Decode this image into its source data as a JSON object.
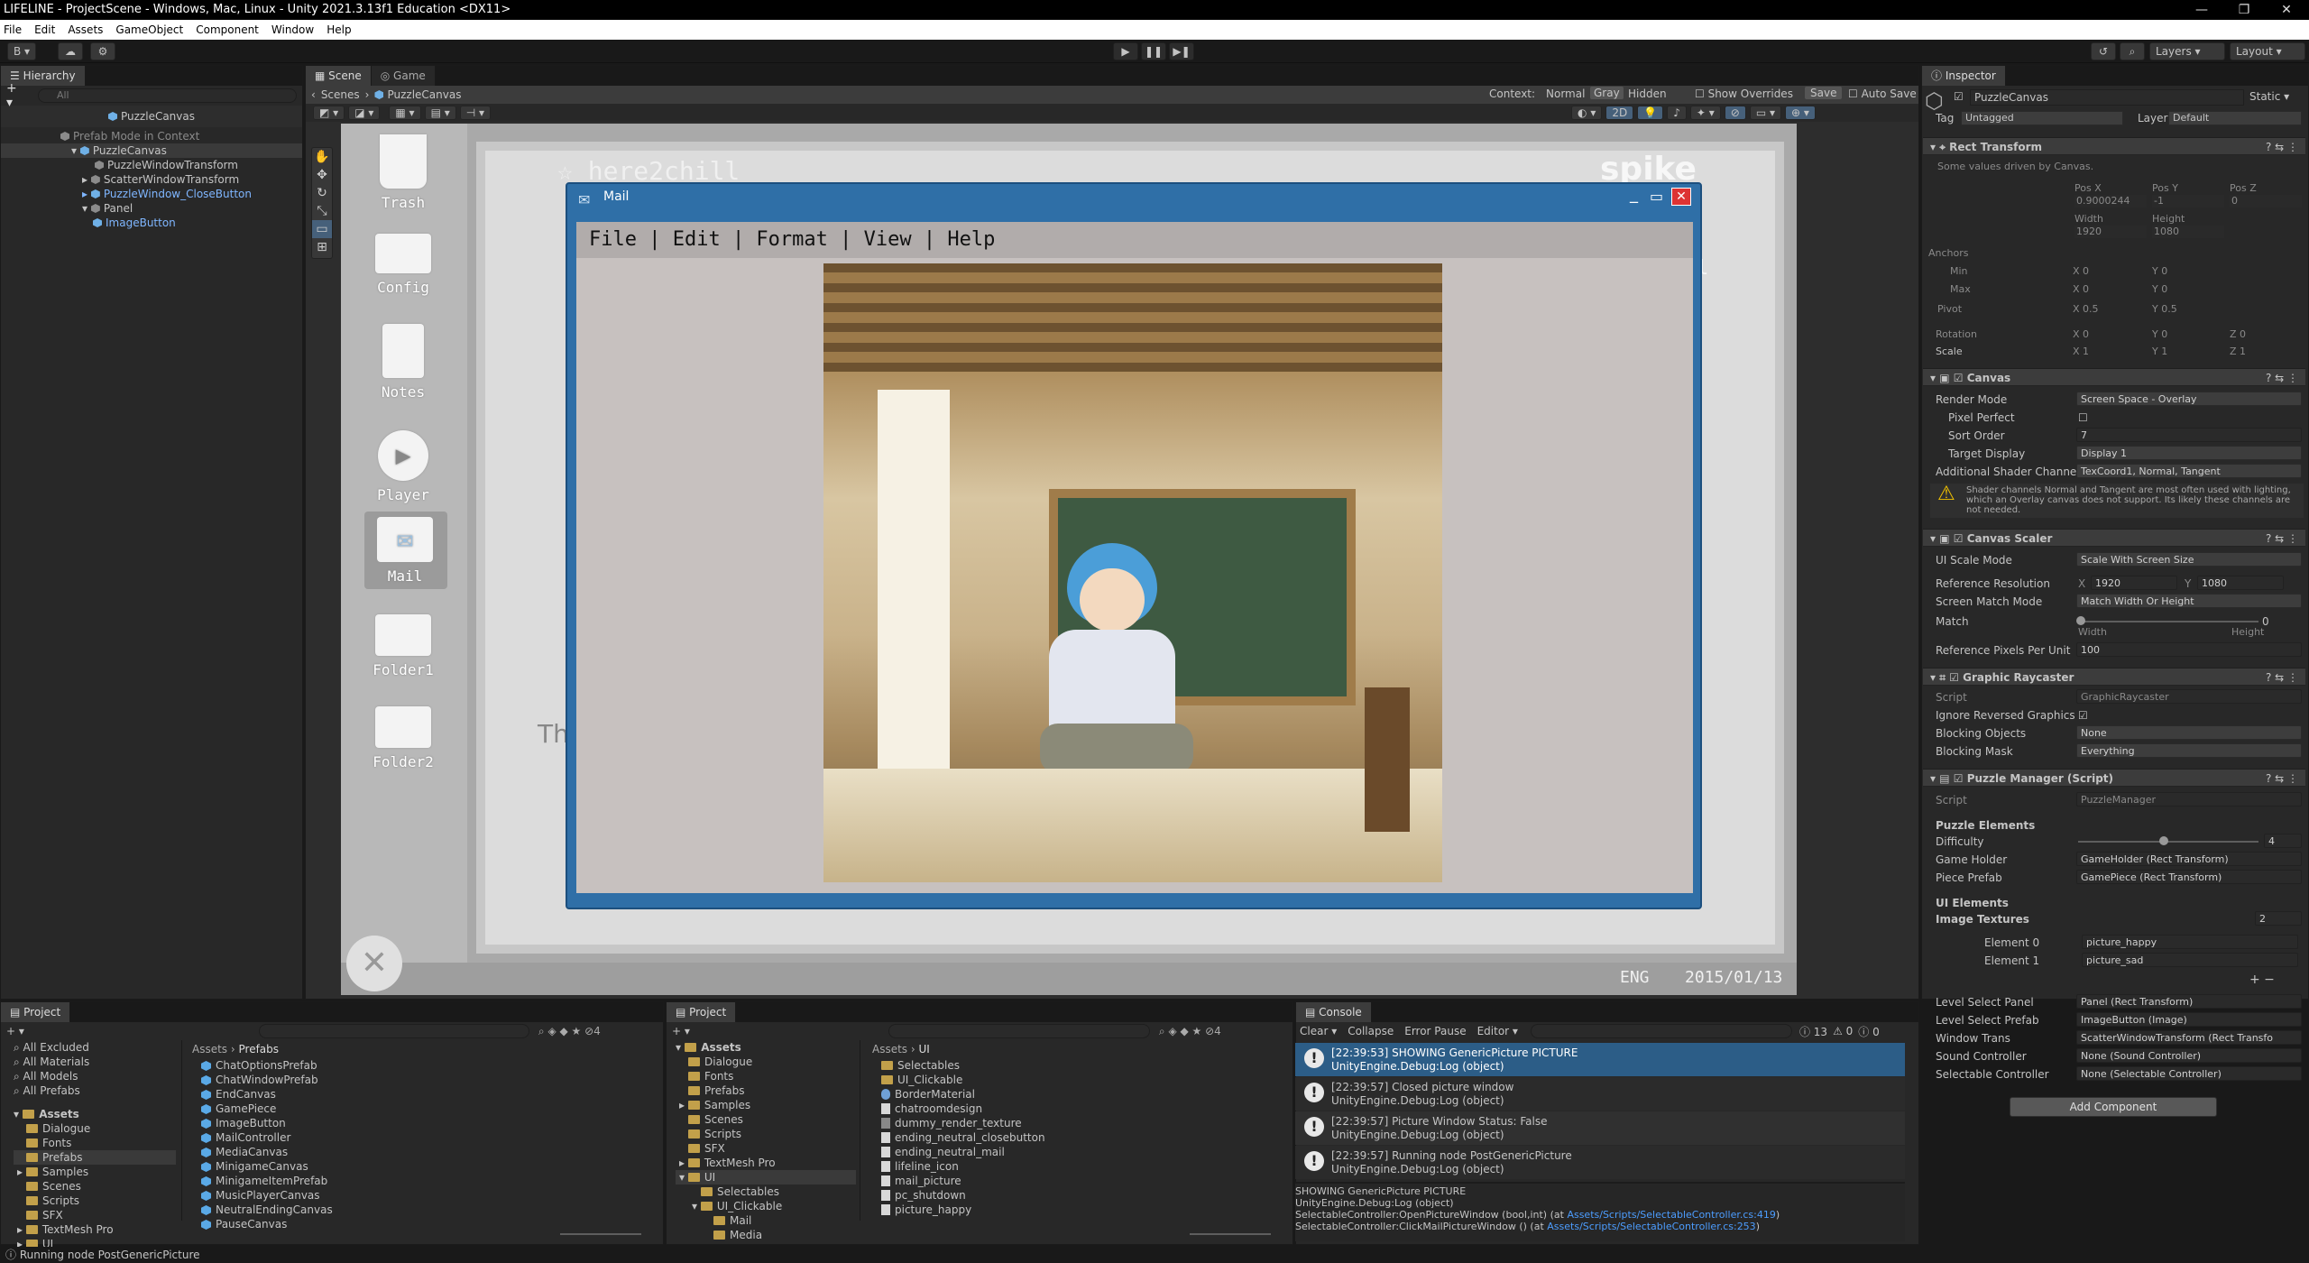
{
  "window": {
    "title": "LIFELINE - ProjectScene - Windows, Mac, Linux - Unity 2021.3.13f1 Education <DX11>",
    "controls": [
      "—",
      "❐",
      "✕"
    ]
  },
  "menubar": [
    "File",
    "Edit",
    "Assets",
    "GameObject",
    "Component",
    "Window",
    "Help"
  ],
  "toolbar": {
    "account": "B ▾",
    "layers": "Layers",
    "layout": "Layout"
  },
  "hierarchy": {
    "tab": "Hierarchy",
    "search_placeholder": "All",
    "root": "PuzzleCanvas",
    "items": [
      {
        "label": "Prefab Mode in Context",
        "indent": 3,
        "style": "gray"
      },
      {
        "label": "PuzzleCanvas",
        "indent": 4,
        "style": "sel"
      },
      {
        "label": "PuzzleWindowTransform",
        "indent": 5,
        "style": "normal"
      },
      {
        "label": "ScatterWindowTransform",
        "indent": 5,
        "style": "normal"
      },
      {
        "label": "PuzzleWindow_CloseButton",
        "indent": 5,
        "style": "blue"
      },
      {
        "label": "Panel",
        "indent": 5,
        "style": "normal"
      },
      {
        "label": "ImageButton",
        "indent": 6,
        "style": "blue"
      }
    ]
  },
  "scene": {
    "tabs": [
      "Scene",
      "Game"
    ],
    "breadcrumb": [
      "Scenes",
      "PuzzleCanvas"
    ],
    "context_label": "Context:",
    "context_options": [
      "Normal",
      "Gray",
      "Hidden"
    ],
    "show_overrides": "Show Overrides",
    "save": "Save",
    "auto_save": "Auto Save",
    "mode_2d": "2D"
  },
  "game": {
    "desktop_icons": [
      "Trash",
      "Config",
      "Notes",
      "Player",
      "Mail",
      "Folder1",
      "Folder2"
    ],
    "mail_title": "Mail",
    "mail_menu": "File | Edit | Format | View | Help",
    "bg_logo": "here2chill",
    "bg_brand": "spike",
    "bg_chat": "chill",
    "bg_text": "Th",
    "taskbar_lang": "ENG",
    "taskbar_date": "2015/01/13"
  },
  "inspector": {
    "tab": "Inspector",
    "object_name": "PuzzleCanvas",
    "static": "Static",
    "tag_label": "Tag",
    "tag": "Untagged",
    "layer_label": "Layer",
    "layer": "Default",
    "rect_transform": {
      "title": "Rect Transform",
      "note": "Some values driven by Canvas.",
      "pos_x": "0.9000244",
      "pos_y": "-1",
      "pos_z": "0",
      "width": "1920",
      "height": "1080",
      "anchor_min_x": "0",
      "anchor_min_y": "0",
      "anchor_max_x": "0",
      "anchor_max_y": "0",
      "pivot_x": "0.5",
      "pivot_y": "0.5",
      "rot_x": "0",
      "rot_y": "0",
      "rot_z": "0",
      "scale_x": "1",
      "scale_y": "1",
      "scale_z": "1"
    },
    "canvas": {
      "title": "Canvas",
      "render_mode": "Screen Space - Overlay",
      "sort_order": "7",
      "target_display": "Display 1",
      "shader_channels": "TexCoord1, Normal, Tangent",
      "warning": "Shader channels Normal and Tangent are most often used with lighting, which an Overlay canvas does not support. Its likely these channels are not needed."
    },
    "scaler": {
      "title": "Canvas Scaler",
      "ui_scale_mode": "Scale With Screen Size",
      "ref_x": "1920",
      "ref_y": "1080",
      "match_mode": "Match Width Or Height",
      "match": "0",
      "match_left": "Width",
      "match_right": "Height",
      "ppu": "100"
    },
    "raycaster": {
      "title": "Graphic Raycaster",
      "script": "GraphicRaycaster",
      "blocking_objects": "None",
      "blocking_mask": "Everything"
    },
    "puzzle": {
      "title": "Puzzle Manager (Script)",
      "script": "PuzzleManager",
      "section": "Puzzle Elements",
      "difficulty": "4",
      "game_holder": "GameHolder (Rect Transform)",
      "piece_prefab": "GamePiece (Rect Transform)",
      "ui_section": "UI Elements",
      "image_textures_label": "Image Textures",
      "image_textures_count": "2",
      "element0_label": "Element 0",
      "element0": "picture_happy",
      "element1_label": "Element 1",
      "element1": "picture_sad",
      "level_select_panel": "Panel (Rect Transform)",
      "level_select_prefab": "ImageButton (Image)",
      "window_trans": "ScatterWindowTransform (Rect Transfo",
      "sound_controller": "None (Sound Controller)",
      "selectable_controller": "None (Selectable Controller)"
    },
    "labels": {
      "pos_x": "Pos X",
      "pos_y": "Pos Y",
      "pos_z": "Pos Z",
      "width": "Width",
      "height": "Height",
      "anchors": "Anchors",
      "min": "Min",
      "max": "Max",
      "pivot": "Pivot",
      "rotation": "Rotation",
      "scale": "Scale",
      "render_mode": "Render Mode",
      "pixel_perfect": "Pixel Perfect",
      "sort_order": "Sort Order",
      "target_display": "Target Display",
      "shader_channels": "Additional Shader Channels",
      "ui_scale_mode": "UI Scale Mode",
      "ref_res": "Reference Resolution",
      "match_mode": "Screen Match Mode",
      "match": "Match",
      "ppu": "Reference Pixels Per Unit",
      "script": "Script",
      "ignore_reversed": "Ignore Reversed Graphics",
      "blocking_objects": "Blocking Objects",
      "blocking_mask": "Blocking Mask",
      "difficulty": "Difficulty",
      "game_holder": "Game Holder",
      "piece_prefab": "Piece Prefab",
      "level_select_panel": "Level Select Panel",
      "level_select_prefab": "Level Select Prefab",
      "window_trans": "Window Trans",
      "sound_controller": "Sound Controller",
      "selectable_controller": "Selectable Controller",
      "x": "X",
      "y": "Y",
      "z": "Z"
    },
    "add_component": "Add Component"
  },
  "project1": {
    "tab": "Project",
    "favorites": [
      "All Excluded",
      "All Materials",
      "All Models",
      "All Prefabs"
    ],
    "tree": [
      "Assets",
      "Dialogue",
      "Fonts",
      "Prefabs",
      "Samples",
      "Scenes",
      "Scripts",
      "SFX",
      "TextMesh Pro",
      "UI"
    ],
    "breadcrumb": [
      "Assets",
      "Prefabs"
    ],
    "files": [
      "ChatOptionsPrefab",
      "ChatWindowPrefab",
      "EndCanvas",
      "GamePiece",
      "ImageButton",
      "MailController",
      "MediaCanvas",
      "MinigameCanvas",
      "MinigameItemPrefab",
      "MusicPlayerCanvas",
      "NeutralEndingCanvas",
      "PauseCanvas"
    ],
    "count": "4"
  },
  "project2": {
    "tab": "Project",
    "tree": [
      "Assets",
      "Dialogue",
      "Fonts",
      "Prefabs",
      "Samples",
      "Scenes",
      "Scripts",
      "SFX",
      "TextMesh Pro",
      "UI",
      "Selectables",
      "UI_Clickable",
      "Mail",
      "Media"
    ],
    "breadcrumb": [
      "Assets",
      "UI"
    ],
    "files": [
      "Selectables",
      "UI_Clickable",
      "BorderMaterial",
      "chatroomdesign",
      "dummy_render_texture",
      "ending_neutral_closebutton",
      "ending_neutral_mail",
      "lifeline_icon",
      "mail_picture",
      "pc_shutdown",
      "picture_happy"
    ],
    "count": "4"
  },
  "console": {
    "tab": "Console",
    "buttons": [
      "Clear",
      "Collapse",
      "Error Pause",
      "Editor"
    ],
    "counts": {
      "log": "13",
      "warn": "0",
      "error": "0"
    },
    "entries": [
      {
        "line1": "[22:39:53] SHOWING GenericPicture PICTURE",
        "line2": "UnityEngine.Debug:Log (object)"
      },
      {
        "line1": "[22:39:57] Closed picture window",
        "line2": "UnityEngine.Debug:Log (object)"
      },
      {
        "line1": "[22:39:57] Picture Window Status: False",
        "line2": "UnityEngine.Debug:Log (object)"
      },
      {
        "line1": "[22:39:57] Running node PostGenericPicture",
        "line2": "UnityEngine.Debug:Log (object)"
      }
    ],
    "detail": [
      "SHOWING GenericPicture PICTURE",
      "UnityEngine.Debug:Log (object)",
      "SelectableController:OpenPictureWindow (bool,int) (at ",
      "SelectableController:ClickMailPictureWindow () (at "
    ],
    "detail_links": [
      "Assets/Scripts/SelectableController.cs:419",
      "Assets/Scripts/SelectableController.cs:253"
    ]
  },
  "statusbar": "Running node PostGenericPicture",
  "colors": {
    "accent": "#2c5d87",
    "link": "#4c9dff",
    "mail_blue": "#2f6fa7"
  }
}
